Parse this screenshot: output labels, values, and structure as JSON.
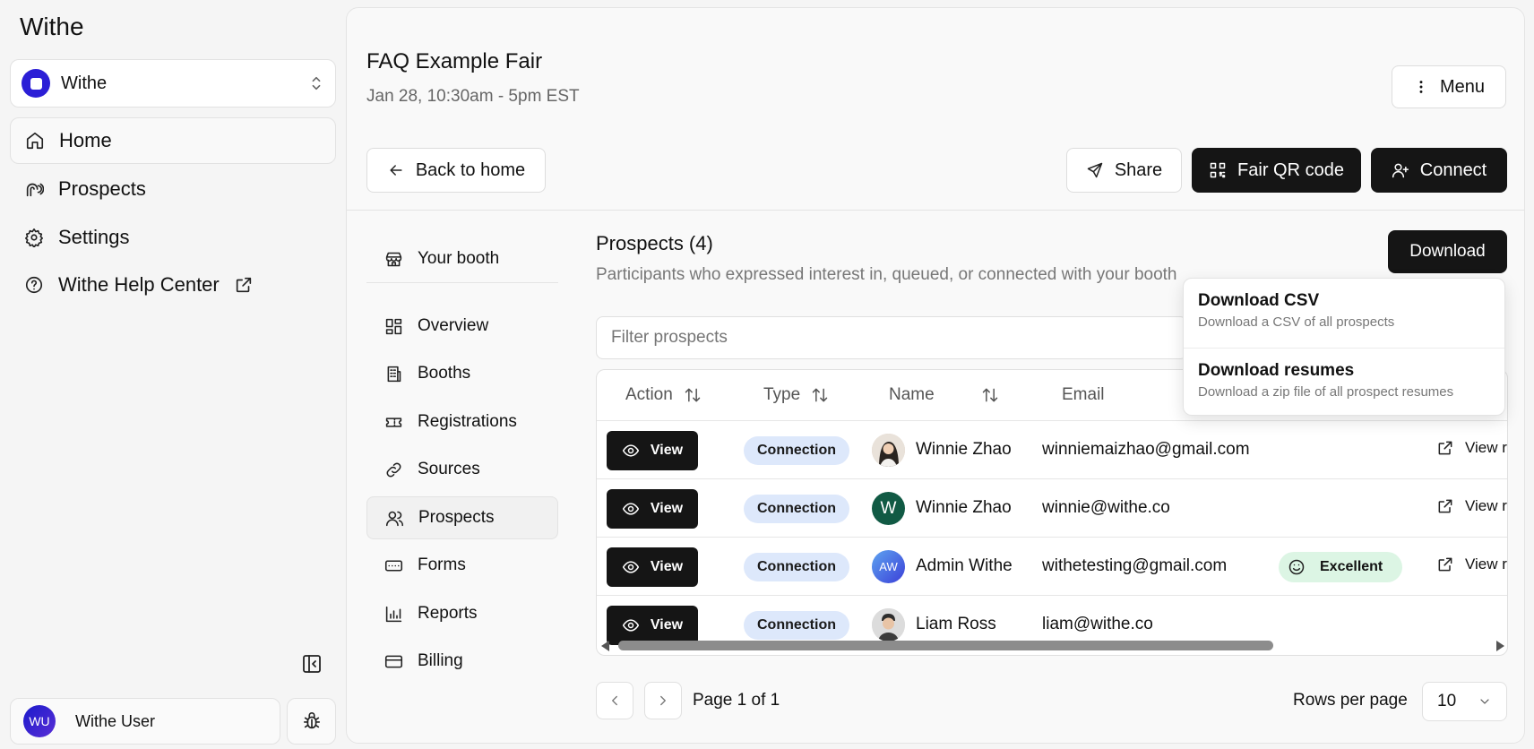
{
  "app": {
    "title": "Withe"
  },
  "org_switcher": {
    "label": "Withe"
  },
  "sidebar": {
    "items": [
      {
        "label": "Home",
        "icon": "home-icon"
      },
      {
        "label": "Prospects",
        "icon": "prospects-icon"
      },
      {
        "label": "Settings",
        "icon": "gear-icon"
      },
      {
        "label": "Withe Help Center",
        "icon": "help-icon"
      }
    ]
  },
  "user": {
    "initials": "WU",
    "name": "Withe User"
  },
  "fair": {
    "title": "FAQ Example Fair",
    "date": "Jan 28, 10:30am - 5pm EST"
  },
  "header": {
    "menu_label": "Menu",
    "back_label": "Back to home",
    "share_label": "Share",
    "qr_label": "Fair QR code",
    "connect_label": "Connect"
  },
  "subnav": {
    "booth": "Your booth",
    "items": [
      "Overview",
      "Booths",
      "Registrations",
      "Sources",
      "Prospects",
      "Forms",
      "Reports",
      "Billing"
    ],
    "active": "Prospects"
  },
  "prospects": {
    "title": "Prospects (4)",
    "subtitle": "Participants who expressed interest in, queued, or connected with your booth",
    "download_label": "Download",
    "filter_placeholder": "Filter prospects",
    "columns": {
      "action": "Action",
      "type": "Type",
      "name": "Name",
      "email": "Email"
    },
    "rows": [
      {
        "action": "View",
        "type": "Connection",
        "name": "Winnie Zhao",
        "email": "winniemaizhao@gmail.com",
        "rating": "",
        "resume": "View r",
        "avatar": "photo"
      },
      {
        "action": "View",
        "type": "Connection",
        "name": "Winnie Zhao",
        "email": "winnie@withe.co",
        "rating": "",
        "resume": "View r",
        "avatar_initial": "W"
      },
      {
        "action": "View",
        "type": "Connection",
        "name": "Admin Withe",
        "email": "withetesting@gmail.com",
        "rating": "Excellent",
        "resume": "View r",
        "avatar_initial": "AW"
      },
      {
        "action": "View",
        "type": "Connection",
        "name": "Liam Ross",
        "email": "liam@withe.co",
        "rating": "",
        "resume": "",
        "avatar": "photo"
      }
    ],
    "pagination": {
      "page_info": "Page 1 of 1",
      "rows_per_page_label": "Rows per page",
      "rows_per_page": "10"
    }
  },
  "download_menu": {
    "items": [
      {
        "title": "Download CSV",
        "description": "Download a CSV of all prospects"
      },
      {
        "title": "Download resumes",
        "description": "Download a zip file of all prospect resumes"
      }
    ]
  },
  "colors": {
    "accent": "#151515",
    "brand": "#2b1ed6",
    "connection_badge": "#dde8fb",
    "rating_badge": "#dcf5e4"
  }
}
